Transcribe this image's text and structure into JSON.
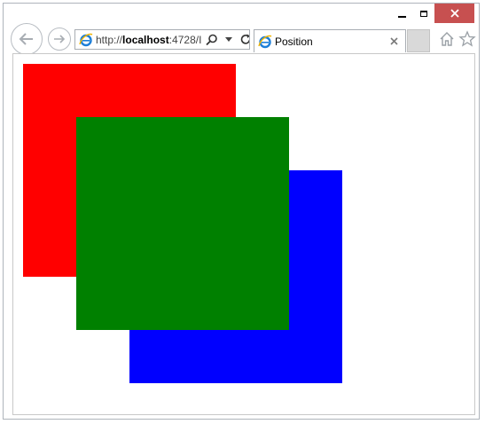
{
  "browser": {
    "address_bar": {
      "url_prefix": "http://",
      "url_host": "localhost",
      "url_rest": ":4728/I"
    },
    "tab": {
      "title": "Position"
    },
    "icons": {
      "back": "back-arrow-icon",
      "forward": "forward-arrow-icon",
      "search": "search-icon",
      "dropdown": "chevron-down-icon",
      "refresh": "refresh-icon",
      "close_tab": "close-icon",
      "home": "home-icon",
      "favorites": "star-icon"
    }
  },
  "page": {
    "boxes": [
      {
        "name": "red",
        "color": "#ff0000"
      },
      {
        "name": "blue",
        "color": "#0000ff"
      },
      {
        "name": "green",
        "color": "#008000"
      }
    ]
  },
  "colors": {
    "close_button": "#c75050"
  }
}
